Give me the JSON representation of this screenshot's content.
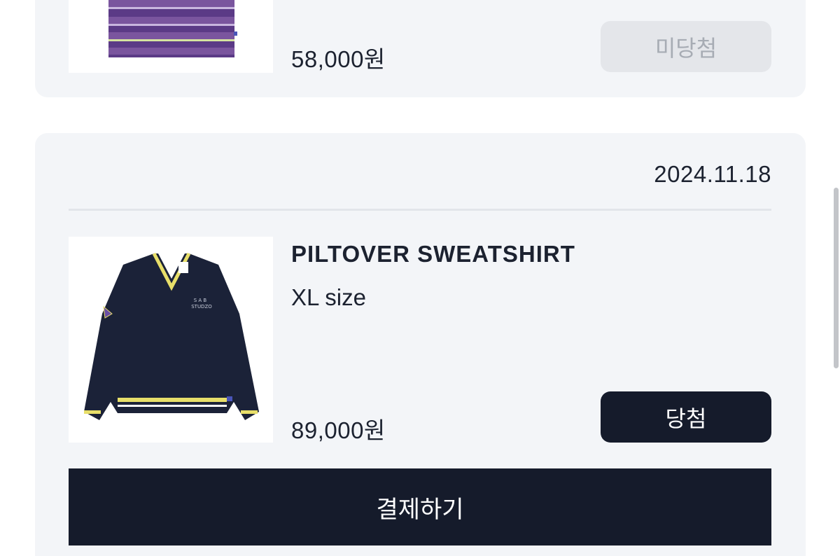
{
  "orders": [
    {
      "price": "58,000원",
      "status_label": "미당첨",
      "thumbnail_icon": "striped-shirt-thumbnail"
    },
    {
      "date": "2024.11.18",
      "product_name": "PILTOVER SWEATSHIRT",
      "size": "XL size",
      "price": "89,000원",
      "status_label": "당첨",
      "thumbnail_icon": "navy-sweatshirt-thumbnail",
      "logo_text": "SAB STUDZO",
      "pay_label": "결제하기"
    }
  ],
  "colors": {
    "card_bg": "#f3f5f8",
    "primary_dark": "#151b2b",
    "disabled_bg": "#e4e6ea",
    "disabled_text": "#a7acb4",
    "text": "#1c2230"
  }
}
